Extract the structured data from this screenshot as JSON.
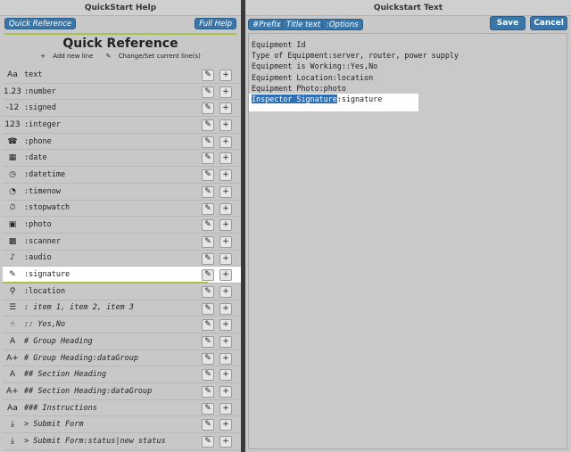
{
  "left_panel": {
    "title": "QuickStart Help",
    "quick_reference_button": "Quick Reference",
    "full_help_button": "Full Help",
    "heading": "Quick Reference",
    "add_new_line": "Add new line",
    "change_set_line": "Change/Set current line(s)",
    "items": [
      {
        "icon": "Aa",
        "icon_name": "text-icon",
        "label": "text",
        "italic": false
      },
      {
        "icon": "1.23",
        "icon_name": "number-icon",
        "label": ":number",
        "italic": false
      },
      {
        "icon": "-12",
        "icon_name": "signed-icon",
        "label": ":signed",
        "italic": false
      },
      {
        "icon": "123",
        "icon_name": "integer-icon",
        "label": ":integer",
        "italic": false
      },
      {
        "icon": "☎",
        "icon_name": "phone-icon",
        "label": ":phone",
        "italic": false
      },
      {
        "icon": "▦",
        "icon_name": "calendar-icon",
        "label": ":date",
        "italic": false
      },
      {
        "icon": "◷",
        "icon_name": "datetime-icon",
        "label": ":datetime",
        "italic": false
      },
      {
        "icon": "◔",
        "icon_name": "clock-icon",
        "label": ":timenow",
        "italic": false
      },
      {
        "icon": "⏱",
        "icon_name": "stopwatch-icon",
        "label": ":stopwatch",
        "italic": false
      },
      {
        "icon": "▣",
        "icon_name": "photo-icon",
        "label": ":photo",
        "italic": false
      },
      {
        "icon": "▩",
        "icon_name": "scanner-icon",
        "label": ":scanner",
        "italic": false
      },
      {
        "icon": "♪",
        "icon_name": "microphone-icon",
        "label": ":audio",
        "italic": false
      },
      {
        "icon": "✎",
        "icon_name": "pen-icon",
        "label": ":signature",
        "italic": false
      },
      {
        "icon": "⚲",
        "icon_name": "location-pin-icon",
        "label": ":location",
        "italic": false
      },
      {
        "icon": "☰",
        "icon_name": "list-icon",
        "label": ": item 1, item 2, item 3",
        "italic": true
      },
      {
        "icon": "☝",
        "icon_name": "hand-icon",
        "label": ":: Yes,No",
        "italic": true
      },
      {
        "icon": "A",
        "icon_name": "group-heading-icon",
        "label": "# Group Heading",
        "italic": true
      },
      {
        "icon": "A+",
        "icon_name": "group-heading-data-icon",
        "label": "# Group Heading:dataGroup",
        "italic": true
      },
      {
        "icon": "A",
        "icon_name": "section-heading-icon",
        "label": "## Section Heading",
        "italic": true
      },
      {
        "icon": "A+",
        "icon_name": "section-heading-data-icon",
        "label": "## Section Heading:dataGroup",
        "italic": true
      },
      {
        "icon": "Aa",
        "icon_name": "instructions-icon",
        "label": "### Instructions",
        "italic": true
      },
      {
        "icon": "⤓",
        "icon_name": "submit-form-icon",
        "label": "> Submit Form",
        "italic": true
      },
      {
        "icon": "⤓",
        "icon_name": "submit-form-status-icon",
        "label": "> Submit Form:status|new status",
        "italic": true
      }
    ]
  },
  "right_panel": {
    "title": "Quickstart Text",
    "prefix_button": "#Prefix",
    "title_text_button": "Title text",
    "options_button": ":Options",
    "save_button": "Save",
    "cancel_button": "Cancel",
    "lines": [
      "Equipment Id",
      "Type of Equipment:server, router, power supply",
      "Equipment is Working::Yes,No",
      "Equipment Location:location",
      "Equipment Photo:photo"
    ],
    "selected_line_highlight": "Inspector Signature",
    "selected_line_rest": ":signature"
  },
  "colors": {
    "accent": "#3a76a8",
    "selection": "#2f6fb4",
    "underline": "#a6c24a"
  }
}
